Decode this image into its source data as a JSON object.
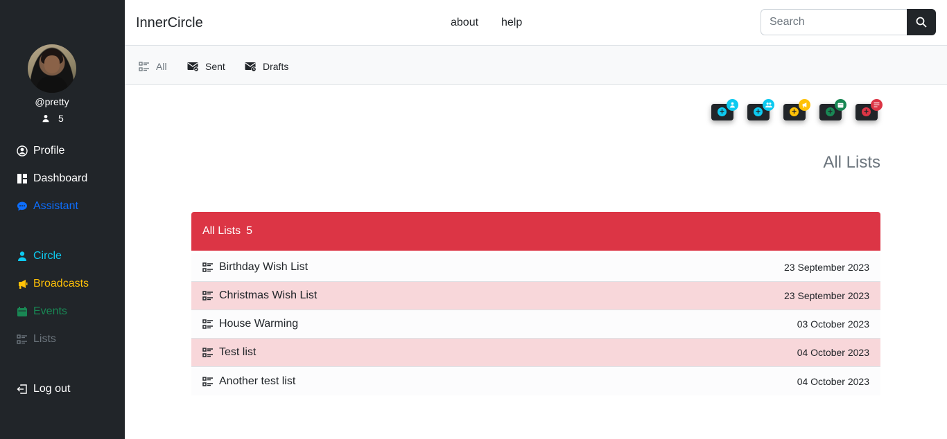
{
  "sidebar": {
    "username": "@pretty",
    "followers_count": "5",
    "nav": [
      {
        "label": "Profile",
        "color": "#ffffff"
      },
      {
        "label": "Dashboard",
        "color": "#ffffff"
      },
      {
        "label": "Assistant",
        "color": "#0d6efd"
      },
      {
        "label": "Circle",
        "color": "#0dcaf0"
      },
      {
        "label": "Broadcasts",
        "color": "#ffc107"
      },
      {
        "label": "Events",
        "color": "#198754"
      },
      {
        "label": "Lists",
        "color": "#6c757d"
      },
      {
        "label": "Log out",
        "color": "#ffffff"
      }
    ]
  },
  "header": {
    "brand": "InnerCircle",
    "links": [
      "about",
      "help"
    ],
    "search_placeholder": "Search"
  },
  "subnav": {
    "items": [
      {
        "label": "All",
        "icon": "list-check-icon",
        "active": true
      },
      {
        "label": "Sent",
        "icon": "envelope-check-icon"
      },
      {
        "label": "Drafts",
        "icon": "envelope-clock-icon"
      }
    ]
  },
  "quick_add": [
    {
      "icon": "person-icon",
      "color": "#0dcaf0"
    },
    {
      "icon": "people-icon",
      "color": "#0dcaf0"
    },
    {
      "icon": "megaphone-icon",
      "color": "#ffc107"
    },
    {
      "icon": "calendar-icon",
      "color": "#198754"
    },
    {
      "icon": "list-icon",
      "color": "#dc3545"
    }
  ],
  "main": {
    "heading": "All Lists",
    "card_title": "All Lists",
    "card_count": "5",
    "lists": [
      {
        "title": "Birthday Wish List",
        "date": "23 September 2023"
      },
      {
        "title": "Christmas Wish List",
        "date": "23 September 2023"
      },
      {
        "title": "House Warming",
        "date": "03 October 2023"
      },
      {
        "title": "Test list",
        "date": "04 October 2023"
      },
      {
        "title": "Another test list",
        "date": "04 October 2023"
      }
    ]
  },
  "colors": {
    "sidebar_bg": "#212529",
    "danger": "#dc3545",
    "row_alt": "#f8d7da"
  }
}
